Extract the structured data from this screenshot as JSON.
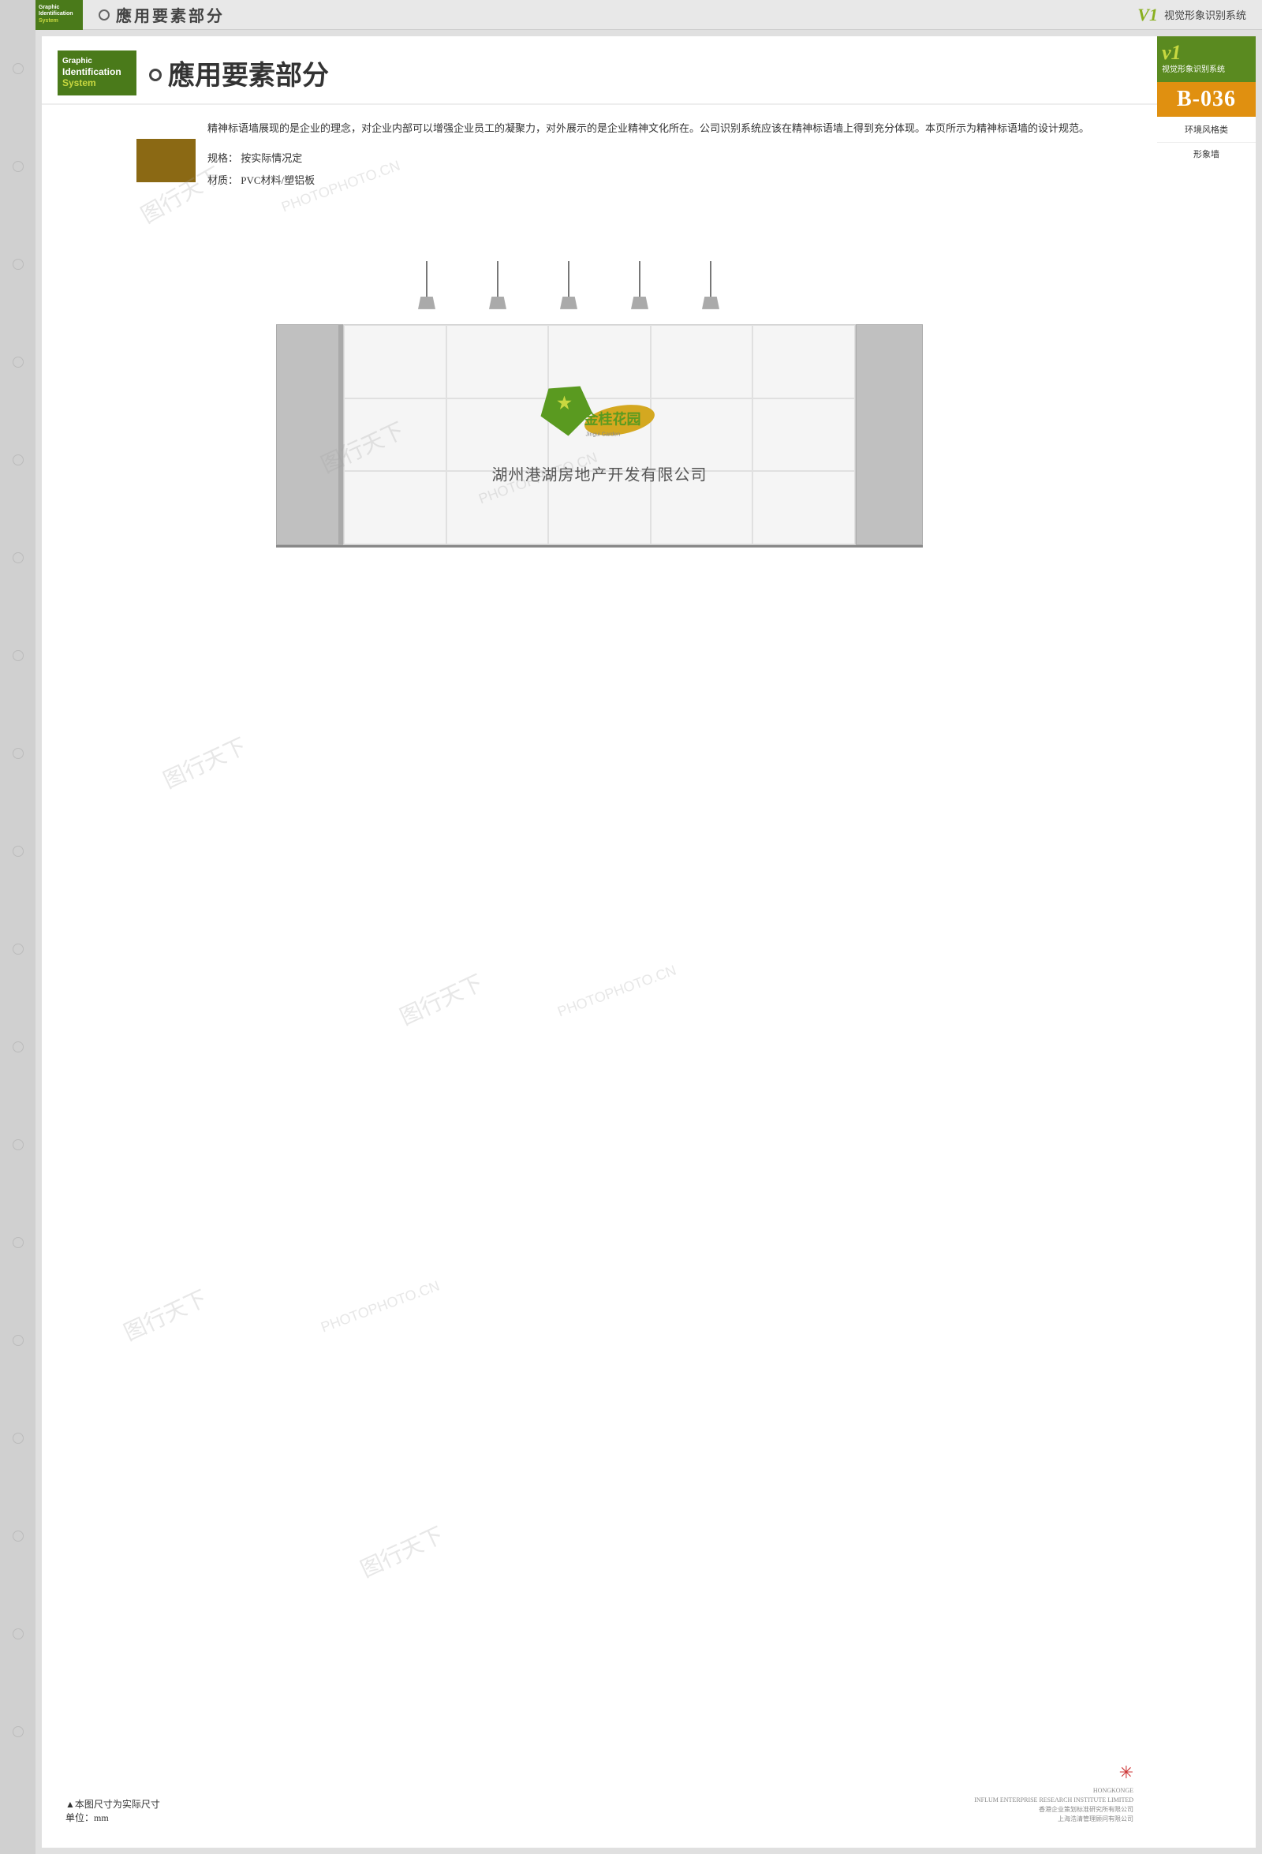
{
  "topbar": {
    "logo_line1": "Graphic",
    "logo_line2": "Identification",
    "logo_line3": "System",
    "nav_title": "應用要素部分",
    "v1_label": "V1",
    "system_title": "视觉形象识别系统"
  },
  "sidebar": {
    "v1": "v1",
    "system_title": "视觉形象识别系统",
    "badge_code": "B-036",
    "category": "环境风格类",
    "subtitle": "形象墙"
  },
  "header": {
    "title": "應用要素部分",
    "logo_line1": "Graphic",
    "logo_line2": "Identification",
    "logo_line3": "System"
  },
  "description": {
    "para1": "精神标语墙展现的是企业的理念，对企业内部可以增强企业员工的凝聚力，对外展示的是企业精神文化所在。公司识别系统应该在精神标语墙上得到充分体现。本页所示为精神标语墙的设计规范。",
    "spec_label": "规格：",
    "spec_value": "按实际情况定",
    "material_label": "材质：",
    "material_value": "PVC材料/塑铝板"
  },
  "wall_design": {
    "company_logo_cn": "金桂花园",
    "company_logo_sub": "JINGUI GARDEN",
    "company_full_name": "湖州港湖房地产开发有限公司"
  },
  "bottom": {
    "note1": "▲本图尺寸为实际尺寸",
    "note2": "单位：mm",
    "company_line1": "HONGKONGE",
    "company_line2": "INFLUM ENTERPRISE RESEARCH INSTITUTE LIMITED",
    "company_line3": "香港企业策划标准研究所有限公司",
    "company_line4": "上海浩清管理顾问有限公司"
  },
  "watermarks": [
    "PHOTOPHOTO.CN",
    "图行天下",
    "图行天下 PHOTOPHOTO.CN",
    "图行天下",
    "PHOTOPHOTO.CN"
  ]
}
